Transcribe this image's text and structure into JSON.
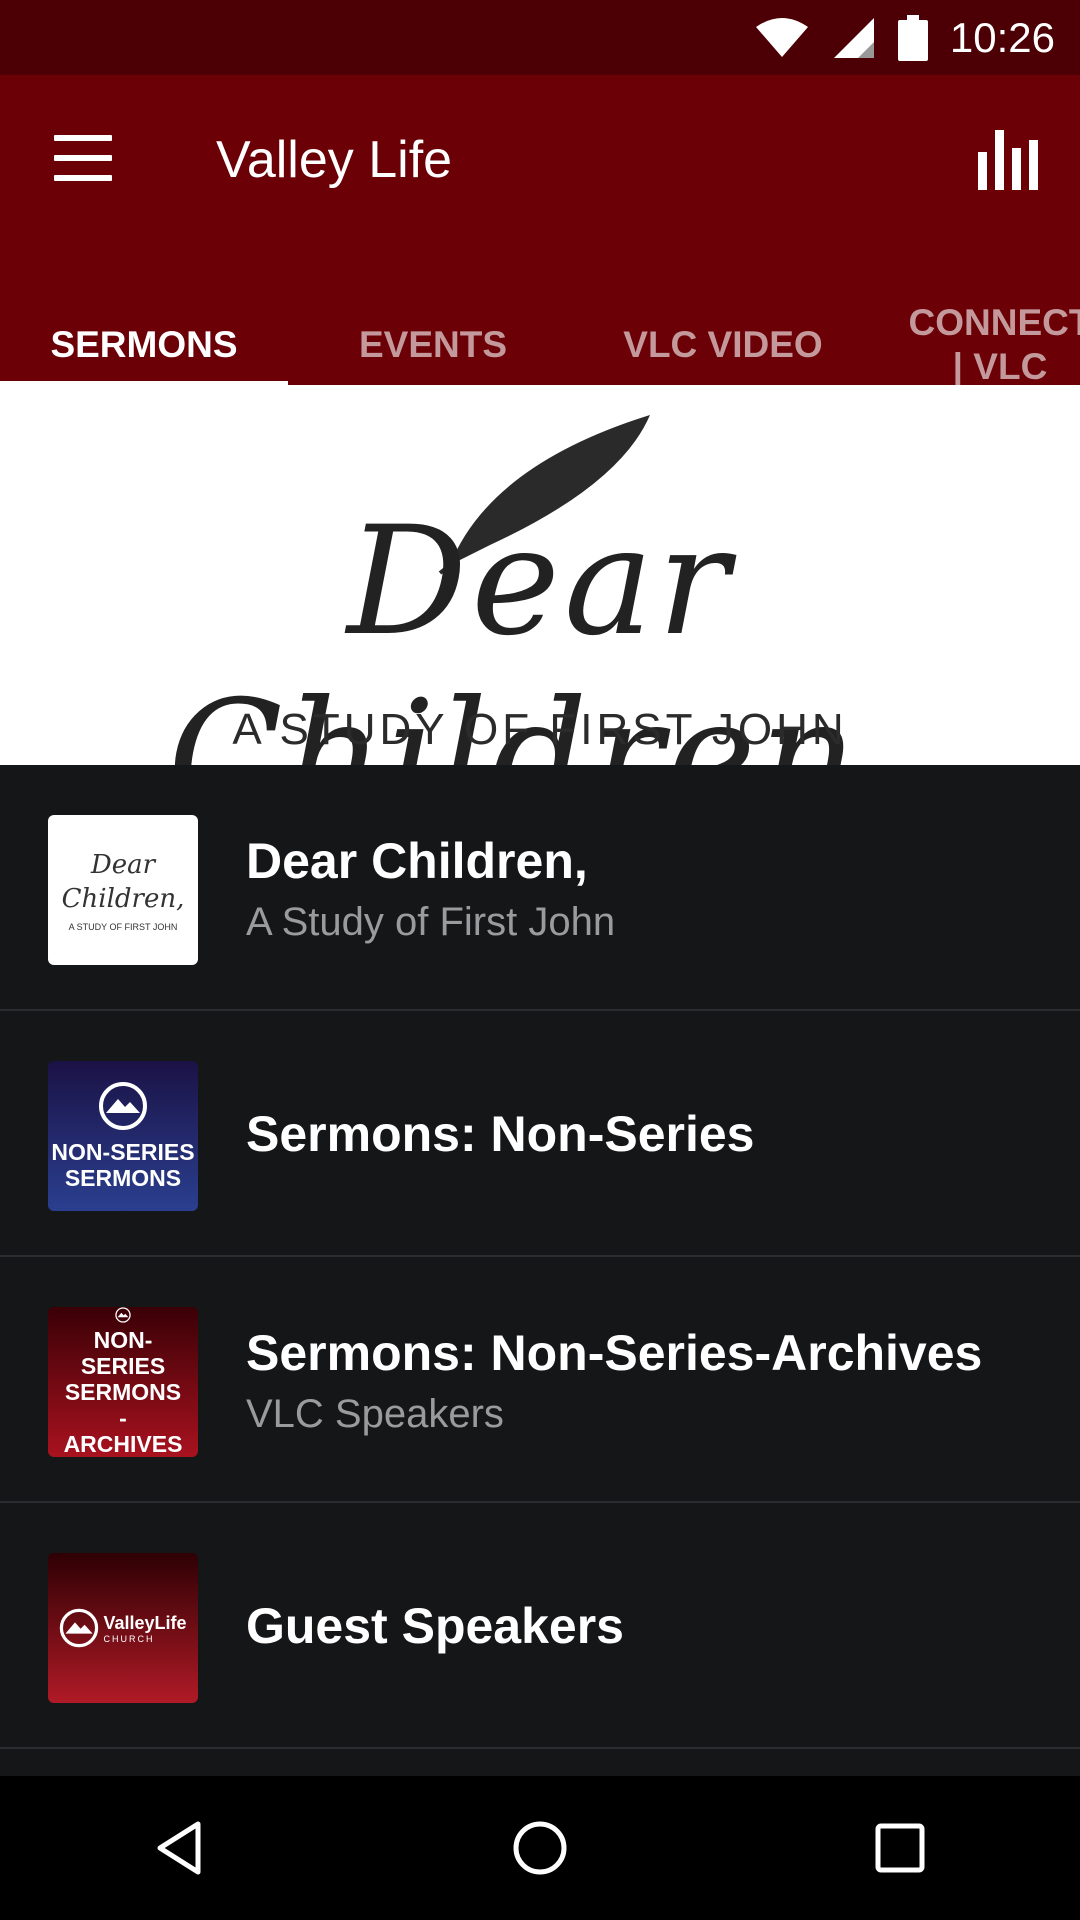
{
  "status": {
    "time": "10:26"
  },
  "app_bar": {
    "title": "Valley Life"
  },
  "tabs": [
    {
      "label": "SERMONS",
      "active": true
    },
    {
      "label": "EVENTS",
      "active": false
    },
    {
      "label": "VLC VIDEO",
      "active": false
    },
    {
      "label": "CONNECT | VLC",
      "active": false
    }
  ],
  "banner": {
    "script_text": "Dear Children,",
    "subtitle": "A STUDY OF FIRST JOHN"
  },
  "items": [
    {
      "title": "Dear Children,",
      "subtitle": "A Study of First John",
      "thumb_text": "Dear Children,",
      "thumb_subtext": "A STUDY OF FIRST JOHN"
    },
    {
      "title": "Sermons: Non-Series",
      "subtitle": "",
      "thumb_text": "NON-SERIES SERMONS"
    },
    {
      "title": "Sermons: Non-Series-Archives",
      "subtitle": "VLC Speakers",
      "thumb_text": "NON-SERIES SERMONS - ARCHIVES"
    },
    {
      "title": "Guest Speakers",
      "subtitle": "",
      "thumb_text": "ValleyLife",
      "thumb_subtext": "CHURCH"
    }
  ],
  "colors": {
    "status_bar": "#4c0005",
    "app_bar": "#6b0007",
    "list_bg": "#151618",
    "nonseries_thumb": "#2a3f8f",
    "archives_thumb": "#8a0f1a"
  },
  "icons": [
    "menu-icon",
    "stats-icon",
    "wifi-icon",
    "signal-icon",
    "battery-icon",
    "back-icon",
    "home-icon",
    "recents-icon"
  ]
}
